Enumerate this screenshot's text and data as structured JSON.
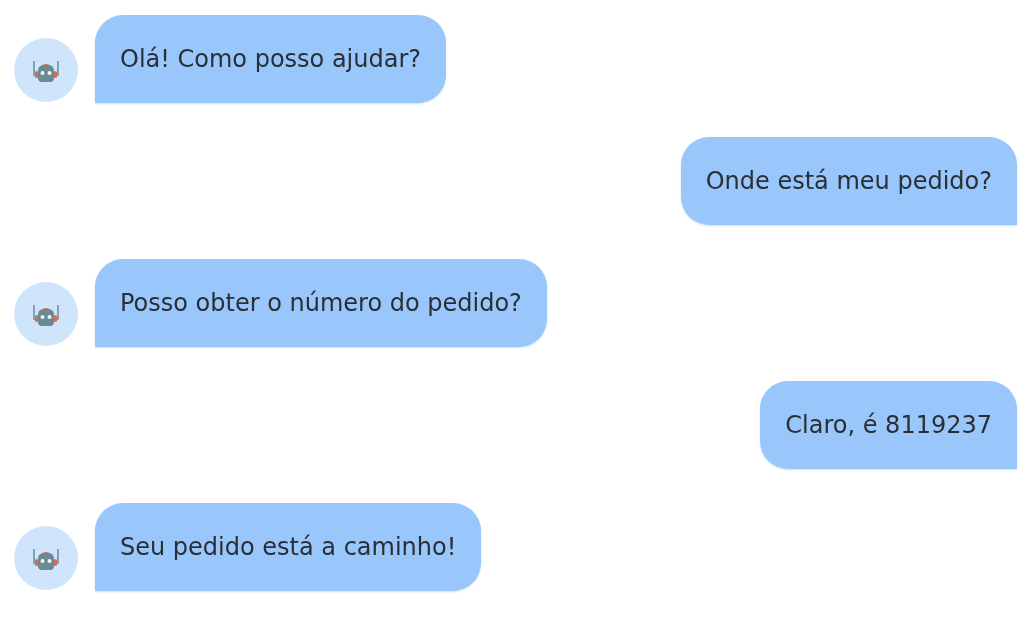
{
  "messages": [
    {
      "kind": "bot",
      "text": "Olá! Como posso ajudar?"
    },
    {
      "kind": "user",
      "text": "Onde está meu pedido?"
    },
    {
      "kind": "bot",
      "text": "Posso obter o número do pedido?"
    },
    {
      "kind": "user",
      "text": "Claro, é 8119237"
    },
    {
      "kind": "bot",
      "text": "Seu pedido está a caminho!"
    }
  ]
}
